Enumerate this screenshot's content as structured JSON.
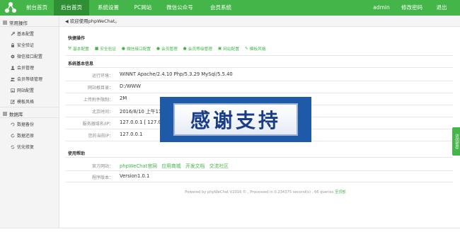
{
  "topnav": {
    "items": [
      "前台首页",
      "后台首页",
      "系统设置",
      "PC网站",
      "微信公众号",
      "会员系统"
    ],
    "active_index": 1,
    "user": "admin",
    "change_password": "修改密码",
    "logout": "退出"
  },
  "sidebar": {
    "group1": "常用操作",
    "group1_items": [
      "基本配置",
      "安全验证",
      "微信接口配置",
      "会员管理",
      "会员等级管理",
      "网站配置",
      "模板风格"
    ],
    "group2": "数据库",
    "group2_items": [
      "数据备份",
      "数据还原",
      "优化修复"
    ]
  },
  "welcome": "欢迎使用phpWeChat。",
  "quick": {
    "title": "快捷操作",
    "items": [
      "基本配置",
      "安全验证",
      "微信接口配置",
      "会员管理",
      "会员等级管理",
      "网站配置",
      "模板风格"
    ]
  },
  "sysinfo": {
    "title": "系统基本信息",
    "rows": [
      {
        "label": "运行环境：",
        "value": "WINNT Apache/2.4.10 Php/5.3.29 MySql/5.5.40"
      },
      {
        "label": "网站根目录：",
        "value": "D:/WWW"
      },
      {
        "label": "上传附件限制：",
        "value": "2M"
      },
      {
        "label": "北京时间：",
        "value": "2016/8/10 上午11"
      },
      {
        "label": "服务器域名/IP：",
        "value": "127.0.0.1 [ 127.0.0"
      },
      {
        "label": "您的当前IP：",
        "value": "127.0.0.1"
      }
    ]
  },
  "help": {
    "title": "使用帮助",
    "official_label": "官方网站：",
    "links": [
      "phpWeChat官网",
      "应用商城",
      "开发文档",
      "交流社区"
    ],
    "version_label": "程序版本：",
    "version": "Version1.0.1"
  },
  "footer": {
    "line1": "Powered by phpWeChat V2016 © , Processed in 0.234375 second(s) , 66 queries",
    "link": "至顶部"
  },
  "overlay_text": "感谢支持",
  "float_tab": "访问密存",
  "colors": {
    "brand_green": "#44b549",
    "active_green": "#2f8f34",
    "banner_blue": "#1f5aa8"
  }
}
